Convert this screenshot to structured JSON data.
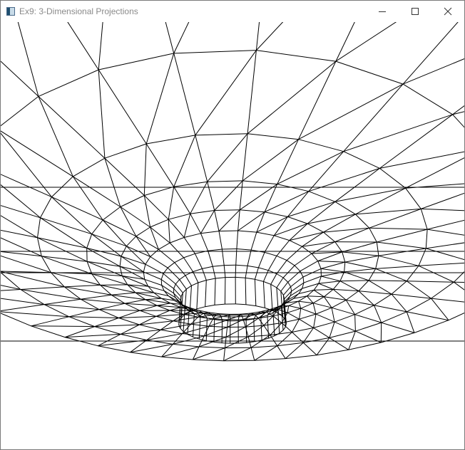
{
  "window": {
    "title": "Ex9: 3-Dimensional Projections",
    "icon": "app-window-icon",
    "controls": [
      "minimize-icon",
      "maximize-icon",
      "close-icon"
    ]
  },
  "scene": {
    "description_type": "wireframe",
    "line_color": "#000000",
    "background_color": "#ffffff"
  }
}
